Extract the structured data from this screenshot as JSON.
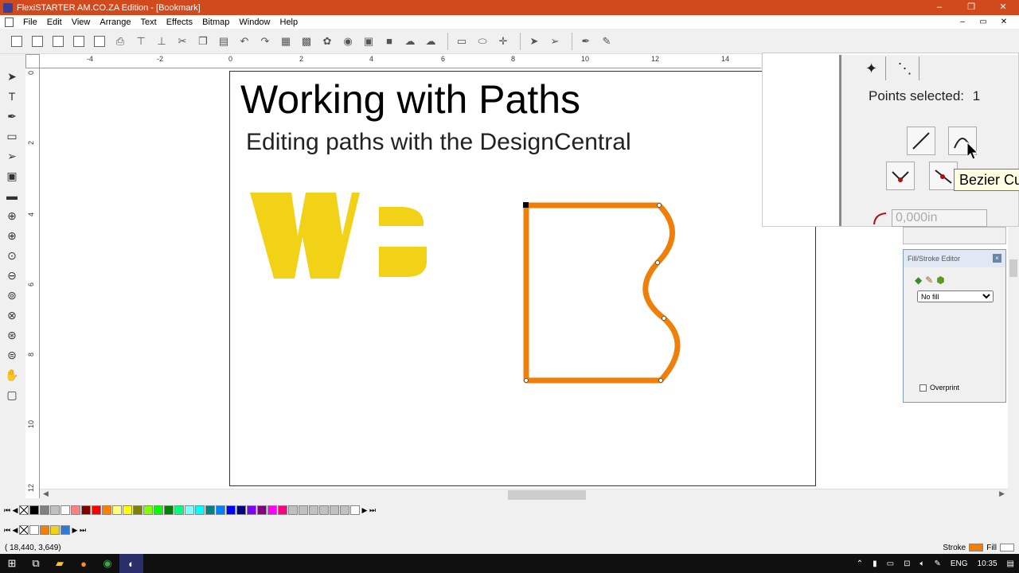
{
  "window": {
    "title": "FlexiSTARTER AM.CO.ZA Edition - [Bookmark]",
    "controls": [
      "–",
      "❐",
      "✕"
    ],
    "mdi_controls": [
      "–",
      "▭",
      "✕"
    ]
  },
  "menu": [
    "File",
    "Edit",
    "View",
    "Arrange",
    "Text",
    "Effects",
    "Bitmap",
    "Window",
    "Help"
  ],
  "ruler": {
    "top_ticks": [
      "-4",
      "-2",
      "0",
      "2",
      "4",
      "6",
      "8",
      "10",
      "12",
      "14"
    ],
    "left_ticks": [
      "0",
      "2",
      "4",
      "6",
      "8",
      "10",
      "12"
    ]
  },
  "document": {
    "heading": "Working with Paths",
    "subheading": "Editing paths with the DesignCentral",
    "logo_colors": {
      "wb": "#f2d216",
      "path_stroke": "#f07f0a"
    }
  },
  "design_central": {
    "points_selected_label": "Points selected:",
    "points_selected_value": "1",
    "tooltip": "Bezier Cu",
    "value_input": "0,000in"
  },
  "fill_stroke": {
    "title": "Fill/Stroke Editor",
    "fill_option": "No fill",
    "overprint_label": "Overprint"
  },
  "palette": {
    "row1": [
      "#000000",
      "#808080",
      "#c0c0c0",
      "#ffffff",
      "#ff8080",
      "#800000",
      "#ff0000",
      "#ff8000",
      "#ffff80",
      "#ffff00",
      "#808000",
      "#80ff00",
      "#00ff00",
      "#008000",
      "#00ff80",
      "#80ffff",
      "#00ffff",
      "#008080",
      "#0080ff",
      "#0000ff",
      "#000080",
      "#8000ff",
      "#800080",
      "#ff00ff",
      "#ff0080",
      "#c0c0c0",
      "#c0c0c0",
      "#c0c0c0",
      "#c0c0c0",
      "#c0c0c0",
      "#c0c0c0",
      "#ffffff"
    ],
    "row2": [
      "#ffffff",
      "#f07f0a",
      "#f2d216",
      "#2e7bd6"
    ]
  },
  "status": {
    "coords": "( 18,440,    3,649)",
    "stroke_label": "Stroke",
    "fill_label": "Fill",
    "stroke_color": "#f07f0a"
  },
  "taskbar": {
    "lang": "ENG",
    "time": "10:35"
  }
}
